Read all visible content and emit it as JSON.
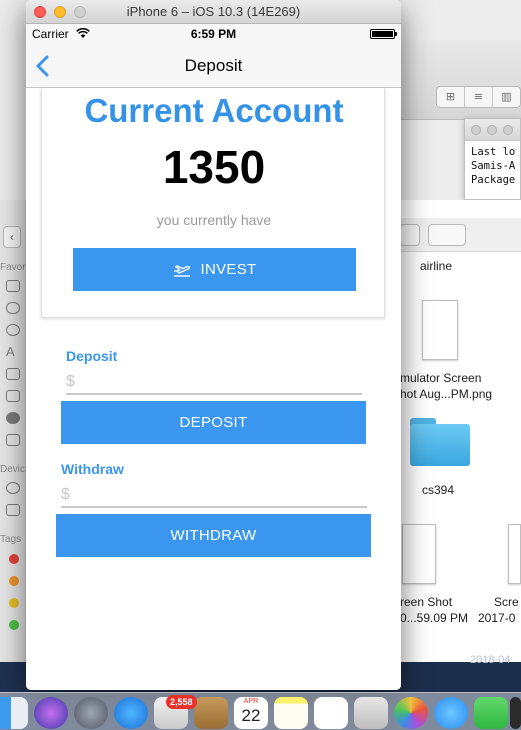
{
  "simulator": {
    "window_title": "iPhone 6 – iOS 10.3 (14E269)"
  },
  "status_bar": {
    "carrier": "Carrier",
    "time": "6:59 PM"
  },
  "nav": {
    "title": "Deposit"
  },
  "account_card": {
    "title": "Current Account",
    "amount": "1350",
    "caption": "you currently have",
    "invest_label": "INVEST"
  },
  "deposit": {
    "label": "Deposit",
    "placeholder": "$",
    "button_label": "DEPOSIT"
  },
  "withdraw": {
    "label": "Withdraw",
    "placeholder": "$",
    "button_label": "WITHDRAW"
  },
  "background_finder": {
    "terminal_lines": [
      "Last lo",
      "Samis-A",
      "Package"
    ],
    "sidebar_labels": [
      "Favor",
      "Devic",
      "Tags"
    ],
    "files": [
      {
        "label": "airline"
      },
      {
        "label_line1": "mulator Screen",
        "label_line2": "hot Aug...PM.png"
      },
      {
        "label": "cs394"
      },
      {
        "label_line1": "reen Shot",
        "label_line2": "0...59.09 PM"
      },
      {
        "label_line1": "Scre",
        "label_line2": "2017-0"
      }
    ],
    "partial_date": "2018-04"
  },
  "dock": {
    "mail_badge": "2,558",
    "calendar_month": "APR",
    "calendar_day": "22"
  },
  "colors": {
    "accent": "#3a96ee",
    "title_blue": "#3493e6"
  }
}
